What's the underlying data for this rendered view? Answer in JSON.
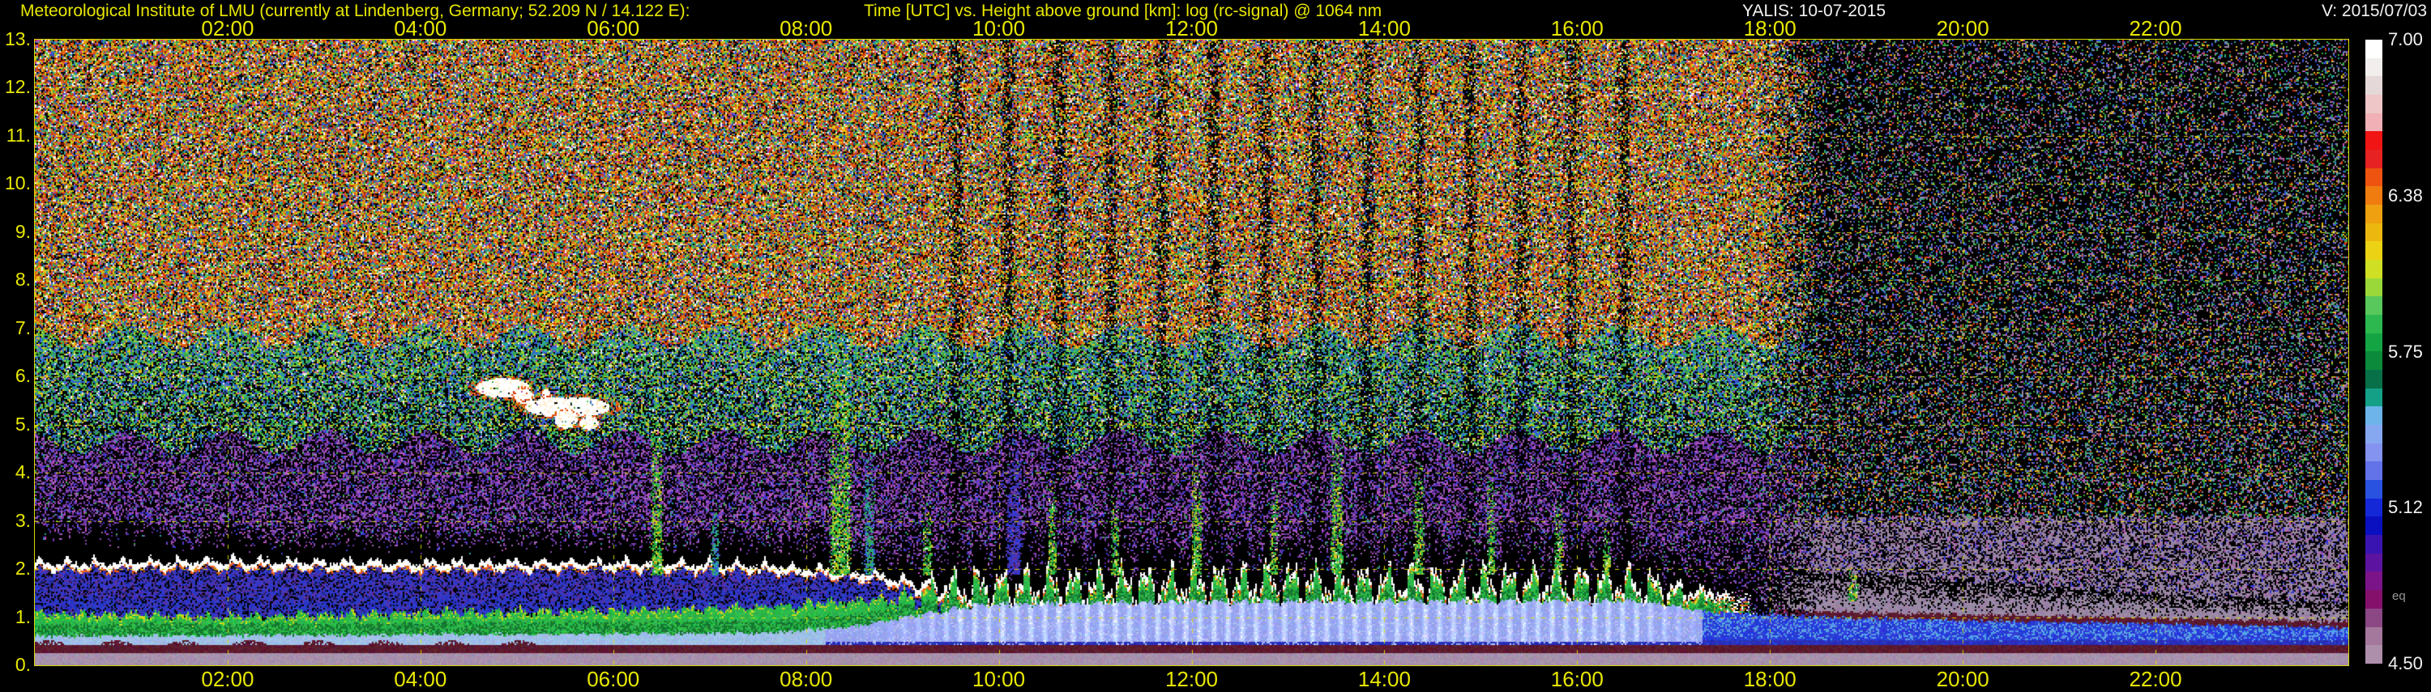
{
  "chart_data": {
    "type": "heatmap",
    "station_label": "Meteorological Institute of LMU (currently at Lindenberg, Germany; 52.209 N / 14.122 E):",
    "title": "Time [UTC] vs. Height above ground [km]: log (rc-signal) @ 1064 nm",
    "dataset_label": "YALIS: 10-07-2015",
    "version_label": "V: 2015/07/03",
    "x_axis": {
      "label": "Time [UTC]",
      "range_hours": [
        0,
        24
      ],
      "tick_hours": [
        2,
        4,
        6,
        8,
        10,
        12,
        14,
        16,
        18,
        20,
        22
      ],
      "tick_labels": [
        "02:00",
        "04:00",
        "06:00",
        "08:00",
        "10:00",
        "12:00",
        "14:00",
        "16:00",
        "18:00",
        "20:00",
        "22:00"
      ]
    },
    "y_axis": {
      "label": "Height above ground [km]",
      "range_km": [
        0,
        13
      ],
      "tick_km": [
        13,
        12,
        11,
        10,
        9,
        8,
        7,
        6,
        5,
        4,
        3,
        2,
        1,
        0
      ],
      "tick_labels": [
        "13.",
        "12.",
        "11.",
        "10.",
        "9.",
        "8.",
        "7.",
        "6.",
        "5.",
        "4.",
        "3.",
        "2.",
        "1.",
        "0."
      ]
    },
    "colorbar": {
      "quantity": "log (rc-signal) @ 1064 nm",
      "tick_labels": [
        "7.00",
        "6.38",
        "5.75",
        "5.12",
        "4.50"
      ],
      "tick_values": [
        7.0,
        6.375,
        5.75,
        5.125,
        4.5
      ],
      "range": [
        4.5,
        7.0
      ],
      "eq_label": "eq",
      "colors": [
        "#ffffff",
        "#f2eeee",
        "#e4d8d8",
        "#eec6c8",
        "#f0b0b6",
        "#f01414",
        "#e62222",
        "#ee5410",
        "#f07c10",
        "#eea010",
        "#ecb810",
        "#ecd214",
        "#cfe024",
        "#9ad83a",
        "#58c85c",
        "#2cb84e",
        "#14a444",
        "#0a8a3a",
        "#087048",
        "#14a086",
        "#6cb4ea",
        "#86a8f0",
        "#8492f0",
        "#6272e8",
        "#2a52e0",
        "#1428d8",
        "#0a10c0",
        "#3a14b0",
        "#5c14a0",
        "#7a1488",
        "#84106c",
        "#8c4884",
        "#a4789c",
        "#ae8fab"
      ]
    },
    "grid": {
      "color": "#e4e400",
      "dash": [
        5,
        8
      ],
      "h_lines_km": [
        1,
        2,
        3,
        4,
        5,
        6,
        7,
        8,
        9,
        10,
        11,
        12
      ],
      "v_lines_hours": [
        2,
        4,
        6,
        8,
        10,
        12,
        14,
        16,
        18,
        20,
        22
      ]
    },
    "render": {
      "seed": 20150710,
      "ph": [
        1.3,
        4.1,
        2.2,
        0.7,
        5.1,
        2.9,
        3.7,
        1.9,
        0.4
      ],
      "h_blue": [
        [
          0,
          0.62
        ],
        [
          5,
          0.66
        ],
        [
          7.5,
          0.68
        ],
        [
          8.4,
          0.8
        ],
        [
          9.8,
          1.28
        ],
        [
          12,
          1.33
        ],
        [
          16.6,
          1.35
        ],
        [
          17.4,
          1.12
        ],
        [
          18.5,
          1.02
        ],
        [
          20,
          0.95
        ],
        [
          22,
          0.88
        ],
        [
          24,
          0.8
        ]
      ],
      "h_green": [
        [
          0,
          1.1
        ],
        [
          2,
          1.02
        ],
        [
          4,
          1.1
        ],
        [
          6,
          1.16
        ],
        [
          7.5,
          1.22
        ],
        [
          8.6,
          1.35
        ],
        [
          9.8,
          1.52
        ],
        [
          13,
          1.6
        ],
        [
          16.4,
          1.58
        ],
        [
          17.2,
          1.42
        ],
        [
          17.8,
          1.3
        ]
      ],
      "h_line": [
        [
          0,
          2.02
        ],
        [
          2,
          2.06
        ],
        [
          4,
          2.02
        ],
        [
          6,
          2.04
        ],
        [
          7.5,
          1.98
        ],
        [
          8.7,
          1.8
        ],
        [
          9.7,
          1.62
        ]
      ],
      "h_mauve": [
        [
          17.9,
          1.98
        ],
        [
          19,
          1.9
        ],
        [
          20,
          1.78
        ],
        [
          21,
          1.62
        ],
        [
          22,
          1.5
        ],
        [
          23,
          1.38
        ],
        [
          24,
          1.3
        ]
      ],
      "colors": {
        "mauve_ground": "#a791ad",
        "maroon": "#5c1a2e",
        "blue_morning": "#9fc0e8",
        "blue_midday": "#97a5ef",
        "blue_midday_light": "#b6c0f4",
        "blue_low_dark": "#2a2fb8",
        "blue_evening": "#2a3cd8",
        "cyan_patch": "#5aa0e4",
        "green_bright": "#2db84a",
        "green_dark": "#157a30",
        "yellow_fringe": "#c8d820",
        "orange_fringe": "#e8641a",
        "white": "#ffffff",
        "gap_blue": "#2a36c4",
        "mauve_haze": "#9a87a5"
      },
      "palettes": {
        "A": [
          [
            "#e06a14",
            18
          ],
          [
            "#d43a0e",
            14
          ],
          [
            "#e8c01c",
            14
          ],
          [
            "#a8d028",
            8
          ],
          [
            "#38a844",
            10
          ],
          [
            "#2ba4a4",
            7
          ],
          [
            "#3a55d6",
            8
          ],
          [
            "#c04fb0",
            5
          ],
          [
            "#f0f0f0",
            8
          ],
          [
            "#7c1608",
            6
          ],
          [
            "#284a9c",
            4
          ]
        ],
        "B": [
          [
            "#38a844",
            16
          ],
          [
            "#2ba4a4",
            10
          ],
          [
            "#3a55d6",
            12
          ],
          [
            "#a8d028",
            8
          ],
          [
            "#e8c01c",
            6
          ],
          [
            "#2a7ac8",
            8
          ],
          [
            "#58cc58",
            6
          ],
          [
            "#f0f0f0",
            3
          ],
          [
            "#c04fb0",
            3
          ]
        ],
        "C": [
          [
            "#8a48b0",
            14
          ],
          [
            "#6a34a8",
            12
          ],
          [
            "#a864c0",
            8
          ],
          [
            "#3a3ad4",
            8
          ],
          [
            "#c04fc0",
            6
          ],
          [
            "#582a90",
            8
          ],
          [
            "#38a844",
            2
          ],
          [
            "#2ba4a4",
            2
          ]
        ],
        "D": [
          [
            "#9a87a5",
            10
          ],
          [
            "#38a844",
            8
          ],
          [
            "#3a55d6",
            8
          ],
          [
            "#c04fb0",
            4
          ],
          [
            "#e8c01c",
            4
          ],
          [
            "#d43a0e",
            4
          ],
          [
            "#2ba4a4",
            4
          ]
        ],
        "E": [
          [
            "#9a87a5",
            20
          ],
          [
            "#8a6f98",
            10
          ],
          [
            "#3a3ad4",
            4
          ],
          [
            "#c04fb0",
            2
          ]
        ],
        "GAP": [
          [
            "#2a36c4",
            10
          ],
          [
            "#5c2f9a",
            7
          ],
          [
            "#3a3ad4",
            5
          ],
          [
            "#1a1a60",
            4
          ]
        ],
        "G": [
          [
            "#2db84a",
            10
          ],
          [
            "#a8d028",
            6
          ],
          [
            "#157a30",
            5
          ],
          [
            "#e8c01c",
            3
          ],
          [
            "#f0f0f0",
            1
          ]
        ],
        "T": [
          [
            "#2ba4a4",
            8
          ],
          [
            "#38a844",
            6
          ],
          [
            "#3a55d6",
            6
          ]
        ],
        "P": [
          [
            "#3a3ad4",
            8
          ],
          [
            "#5c2f9a",
            6
          ],
          [
            "#2a36c4",
            5
          ]
        ]
      },
      "clouds": [
        {
          "t": 4.85,
          "km": 5.78,
          "w": 0.28,
          "h": 0.2
        },
        {
          "t": 5.07,
          "km": 5.6,
          "w": 0.1,
          "h": 0.16
        },
        {
          "t": 5.3,
          "km": 5.5,
          "w": 0.06,
          "h": 0.26
        },
        {
          "t": 5.52,
          "km": 5.38,
          "w": 0.44,
          "h": 0.22
        },
        {
          "t": 5.5,
          "km": 5.12,
          "w": 0.12,
          "h": 0.18
        },
        {
          "t": 5.74,
          "km": 5.05,
          "w": 0.1,
          "h": 0.14
        }
      ],
      "streaks": [
        {
          "t": 6.45,
          "w": 0.14,
          "top": 5.6,
          "pal": "G"
        },
        {
          "t": 7.05,
          "w": 0.1,
          "top": 3.5,
          "pal": "T"
        },
        {
          "t": 8.35,
          "w": 0.25,
          "top": 6.9,
          "pal": "G"
        },
        {
          "t": 8.65,
          "w": 0.12,
          "top": 4.5,
          "pal": "T"
        },
        {
          "t": 9.25,
          "w": 0.1,
          "top": 3.6,
          "pal": "G"
        },
        {
          "t": 10.15,
          "w": 0.18,
          "top": 4.8,
          "pal": "P"
        },
        {
          "t": 10.55,
          "w": 0.1,
          "top": 3.9,
          "pal": "G"
        },
        {
          "t": 11.2,
          "w": 0.1,
          "top": 3.5,
          "pal": "G"
        },
        {
          "t": 12.05,
          "w": 0.12,
          "top": 4.3,
          "pal": "G"
        },
        {
          "t": 12.85,
          "w": 0.1,
          "top": 3.8,
          "pal": "G"
        },
        {
          "t": 13.5,
          "w": 0.14,
          "top": 5.0,
          "pal": "G"
        },
        {
          "t": 14.35,
          "w": 0.12,
          "top": 4.3,
          "pal": "G"
        },
        {
          "t": 15.1,
          "w": 0.1,
          "top": 3.9,
          "pal": "G"
        },
        {
          "t": 15.8,
          "w": 0.1,
          "top": 3.4,
          "pal": "G"
        },
        {
          "t": 16.3,
          "w": 0.09,
          "top": 3.0,
          "pal": "G"
        },
        {
          "t": 18.85,
          "w": 0.12,
          "top": 2.1,
          "base": 1.35,
          "pal": "G"
        }
      ]
    }
  }
}
